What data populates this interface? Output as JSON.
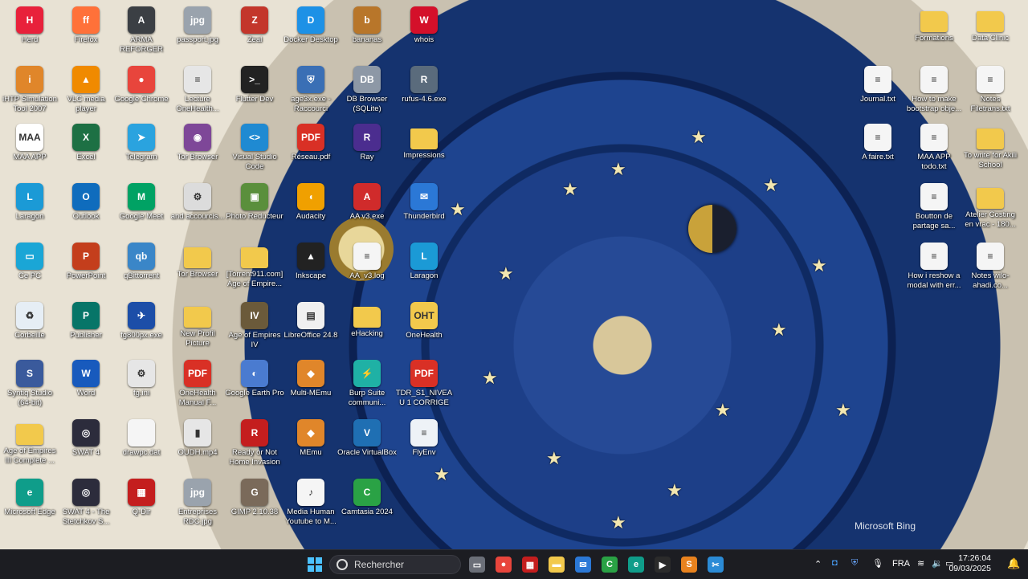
{
  "desktop": {
    "watermark": "Microsoft Bing",
    "icons": [
      {
        "label": "Herd",
        "icon": "herd-icon",
        "color": "#e8213b",
        "glyph": "H"
      },
      {
        "label": "Firefox",
        "icon": "firefox-icon",
        "color": "#ff7139",
        "glyph": "ff"
      },
      {
        "label": "ARMA REFORGER",
        "icon": "arma-icon",
        "color": "#3b3f44",
        "glyph": "A"
      },
      {
        "label": "passport.jpg",
        "icon": "image-file-icon",
        "color": "#9aa3ad",
        "glyph": "jpg"
      },
      {
        "label": "Zeal",
        "icon": "zeal-icon",
        "color": "#c3362b",
        "glyph": "Z"
      },
      {
        "label": "Docker Desktop",
        "icon": "docker-icon",
        "color": "#1d91e6",
        "glyph": "D"
      },
      {
        "label": "bananas",
        "icon": "bananas-icon",
        "color": "#b8762a",
        "glyph": "b"
      },
      {
        "label": "whois",
        "icon": "whois-icon",
        "color": "#d4102a",
        "glyph": "W"
      },
      {
        "label": "iHTP Simulation Tool 2007",
        "icon": "ihtp-icon",
        "color": "#e0862a",
        "glyph": "i"
      },
      {
        "label": "VLC media player",
        "icon": "vlc-icon",
        "color": "#f08a00",
        "glyph": "▲"
      },
      {
        "label": "Google Chrome",
        "icon": "chrome-icon",
        "color": "#e8453c",
        "glyph": "●"
      },
      {
        "label": "Lecture OneHealth...",
        "icon": "document-icon",
        "color": "#e6e6e6",
        "glyph": "≡"
      },
      {
        "label": "Flutter Dev",
        "icon": "terminal-icon",
        "color": "#222",
        "glyph": ">_"
      },
      {
        "label": "age3x.exe - Raccourci",
        "icon": "shield-exe-icon",
        "color": "#3a6fb5",
        "glyph": "⛨"
      },
      {
        "label": "DB Browser (SQLite)",
        "icon": "database-icon",
        "color": "#8d98a6",
        "glyph": "DB"
      },
      {
        "label": "rufus-4.6.exe",
        "icon": "rufus-icon",
        "color": "#5a6b7c",
        "glyph": "R"
      },
      {
        "label": "MAA APP",
        "icon": "maa-icon",
        "color": "#ffffff",
        "glyph": "MAA"
      },
      {
        "label": "Excel",
        "icon": "excel-icon",
        "color": "#1d7044",
        "glyph": "X"
      },
      {
        "label": "Telegram",
        "icon": "telegram-icon",
        "color": "#2aa3df",
        "glyph": "➤"
      },
      {
        "label": "Tor Browser",
        "icon": "tor-icon",
        "color": "#7e4798",
        "glyph": "◉"
      },
      {
        "label": "Visual Studio Code",
        "icon": "vscode-icon",
        "color": "#1f8ad2",
        "glyph": "<>"
      },
      {
        "label": "Réseau.pdf",
        "icon": "pdf-icon",
        "color": "#d93025",
        "glyph": "PDF"
      },
      {
        "label": "Ray",
        "icon": "ray-icon",
        "color": "#4b2d8f",
        "glyph": "R"
      },
      {
        "label": "Impressions",
        "icon": "folder-icon",
        "color": "#f2c94c",
        "glyph": ""
      },
      {
        "label": "Laragon",
        "icon": "laragon-icon",
        "color": "#1b9ad6",
        "glyph": "L"
      },
      {
        "label": "Outlook",
        "icon": "outlook-icon",
        "color": "#0f6cbd",
        "glyph": "O"
      },
      {
        "label": "Google Meet",
        "icon": "meet-icon",
        "color": "#00a264",
        "glyph": "M"
      },
      {
        "label": "and accourcis...",
        "icon": "shortcut-icon",
        "color": "#dcdcdc",
        "glyph": "⚙"
      },
      {
        "label": "Photo Reducteur",
        "icon": "photo-icon",
        "color": "#5a8f3c",
        "glyph": "▣"
      },
      {
        "label": "Audacity",
        "icon": "audacity-icon",
        "color": "#f0a000",
        "glyph": "◖"
      },
      {
        "label": "AA v3.exe",
        "icon": "aa-icon",
        "color": "#d02b2b",
        "glyph": "A"
      },
      {
        "label": "Thunderbird",
        "icon": "thunderbird-icon",
        "color": "#2b78d6",
        "glyph": "✉"
      },
      {
        "label": "Ce PC",
        "icon": "computer-icon",
        "color": "#1aa6d6",
        "glyph": "▭"
      },
      {
        "label": "PowerPoint",
        "icon": "powerpoint-icon",
        "color": "#c43e1c",
        "glyph": "P"
      },
      {
        "label": "qBittorrent",
        "icon": "qbittorrent-icon",
        "color": "#3a86c8",
        "glyph": "qb"
      },
      {
        "label": "Tor Browser",
        "icon": "tor-folder-icon",
        "color": "#f2c94c",
        "glyph": ""
      },
      {
        "label": "[Torrent911.com] Age of Empire...",
        "icon": "folder-icon",
        "color": "#f2c94c",
        "glyph": ""
      },
      {
        "label": "Inkscape",
        "icon": "inkscape-icon",
        "color": "#222",
        "glyph": "▲"
      },
      {
        "label": "AA_v3.log",
        "icon": "text-file-icon",
        "color": "#f5f5f5",
        "glyph": "≡"
      },
      {
        "label": "Laragon",
        "icon": "laragon-icon",
        "color": "#1b9ad6",
        "glyph": "L"
      },
      {
        "label": "Corbeille",
        "icon": "recycle-bin-icon",
        "color": "#e6eef5",
        "glyph": "♻"
      },
      {
        "label": "Publisher",
        "icon": "publisher-icon",
        "color": "#077568",
        "glyph": "P"
      },
      {
        "label": "fg800px.exe",
        "icon": "exe-icon",
        "color": "#1c4ea8",
        "glyph": "✈"
      },
      {
        "label": "New Profil Picture",
        "icon": "folder-icon",
        "color": "#f2c94c",
        "glyph": ""
      },
      {
        "label": "Age of Empires IV",
        "icon": "aoe4-icon",
        "color": "#6b5a3a",
        "glyph": "IV"
      },
      {
        "label": "LibreOffice 24.8",
        "icon": "libreoffice-icon",
        "color": "#f0f0f0",
        "glyph": "▤"
      },
      {
        "label": "eHacking",
        "icon": "folder-icon",
        "color": "#f2c94c",
        "glyph": ""
      },
      {
        "label": "OneHealth",
        "icon": "oht-icon",
        "color": "#f2c94c",
        "glyph": "OHT"
      },
      {
        "label": "Syntiq Studio (64-bit)",
        "icon": "syntiq-icon",
        "color": "#3a5a9c",
        "glyph": "S"
      },
      {
        "label": "Word",
        "icon": "word-icon",
        "color": "#185abd",
        "glyph": "W"
      },
      {
        "label": "fg.ini",
        "icon": "ini-file-icon",
        "color": "#e6e6e6",
        "glyph": "⚙"
      },
      {
        "label": "OneHealth Manual F...",
        "icon": "pdf-icon",
        "color": "#d93025",
        "glyph": "PDF"
      },
      {
        "label": "Google Earth Pro",
        "icon": "google-earth-icon",
        "color": "#4a7bd0",
        "glyph": "◐"
      },
      {
        "label": "Multi-MEmu",
        "icon": "memu-icon",
        "color": "#e0862a",
        "glyph": "◆"
      },
      {
        "label": "Burp Suite communi...",
        "icon": "burp-icon",
        "color": "#1fb1a5",
        "glyph": "⚡"
      },
      {
        "label": "TDR_S1_NIVEAU 1 CORRIGE II.pdf",
        "icon": "pdf-icon",
        "color": "#d93025",
        "glyph": "PDF"
      },
      {
        "label": "Age of Empires III Complete ...",
        "icon": "folder-icon",
        "color": "#f2c94c",
        "glyph": ""
      },
      {
        "label": "SWAT 4",
        "icon": "swat-icon",
        "color": "#2c2c3c",
        "glyph": "◎"
      },
      {
        "label": "drawpc.dat",
        "icon": "blank-file-icon",
        "color": "#f5f5f5",
        "glyph": ""
      },
      {
        "label": "OUDH.mp4",
        "icon": "video-file-icon",
        "color": "#e6e6e6",
        "glyph": "▮"
      },
      {
        "label": "Ready or Not Home Invasion",
        "icon": "ready-or-not-icon",
        "color": "#c41e1e",
        "glyph": "R"
      },
      {
        "label": "MEmu",
        "icon": "memu-icon",
        "color": "#e0862a",
        "glyph": "◆"
      },
      {
        "label": "Oracle VirtualBox",
        "icon": "virtualbox-icon",
        "color": "#1f6fb3",
        "glyph": "V"
      },
      {
        "label": "FlyEnv",
        "icon": "flyenv-icon",
        "color": "#eef2f7",
        "glyph": "≡"
      },
      {
        "label": "Microsoft Edge",
        "icon": "edge-icon",
        "color": "#0f9d8a",
        "glyph": "e"
      },
      {
        "label": "SWAT 4 - The Stetchkov S...",
        "icon": "swat-icon",
        "color": "#2c2c3c",
        "glyph": "◎"
      },
      {
        "label": "Q-Dir",
        "icon": "qdir-icon",
        "color": "#c41e1e",
        "glyph": "▦"
      },
      {
        "label": "Entreprises RDC.jpg",
        "icon": "image-file-icon",
        "color": "#9aa3ad",
        "glyph": "jpg"
      },
      {
        "label": "GIMP 2.10.38",
        "icon": "gimp-icon",
        "color": "#7a6a5a",
        "glyph": "G"
      },
      {
        "label": "Media Human Youtube to M...",
        "icon": "mediahuman-icon",
        "color": "#f5f5f5",
        "glyph": "♪"
      },
      {
        "label": "Camtasia 2024",
        "icon": "camtasia-icon",
        "color": "#2aa245",
        "glyph": "C"
      },
      {
        "label": "Formations",
        "icon": "folder-icon",
        "color": "#f2c94c",
        "glyph": ""
      },
      {
        "label": "Data Clinic",
        "icon": "folder-icon",
        "color": "#f2c94c",
        "glyph": ""
      },
      {
        "label": "Journal.txt",
        "icon": "text-file-icon",
        "color": "#f5f5f5",
        "glyph": "≡"
      },
      {
        "label": "How to make bootstrap obje...",
        "icon": "text-file-icon",
        "color": "#f5f5f5",
        "glyph": "≡"
      },
      {
        "label": "Notes Filetrans.txt",
        "icon": "text-file-icon",
        "color": "#f5f5f5",
        "glyph": "≡"
      },
      {
        "label": "A faire.txt",
        "icon": "text-file-icon",
        "color": "#f5f5f5",
        "glyph": "≡"
      },
      {
        "label": "MAA APP todo.txt",
        "icon": "text-file-icon",
        "color": "#f5f5f5",
        "glyph": "≡"
      },
      {
        "label": "To write for Akili School",
        "icon": "folder-icon",
        "color": "#f2c94c",
        "glyph": ""
      },
      {
        "label": "Boutton de partage sa...",
        "icon": "text-file-icon",
        "color": "#f5f5f5",
        "glyph": "≡"
      },
      {
        "label": "Atelier Costing en vrac - 180...",
        "icon": "folder-icon",
        "color": "#f2c94c",
        "glyph": ""
      },
      {
        "label": "How i reshow a modal with err...",
        "icon": "text-file-icon",
        "color": "#f5f5f5",
        "glyph": "≡"
      },
      {
        "label": "Notes wilo-ahadi.co...",
        "icon": "text-file-icon",
        "color": "#f5f5f5",
        "glyph": "≡"
      }
    ]
  },
  "taskbar": {
    "search_placeholder": "Rechercher",
    "pinned": [
      {
        "name": "task-view-icon",
        "color": "#6b6f78",
        "glyph": "▭"
      },
      {
        "name": "chrome-icon",
        "color": "#e8453c",
        "glyph": "●"
      },
      {
        "name": "qdir-icon",
        "color": "#c41e1e",
        "glyph": "▦"
      },
      {
        "name": "file-explorer-icon",
        "color": "#f2c94c",
        "glyph": "▬"
      },
      {
        "name": "thunderbird-icon",
        "color": "#2b78d6",
        "glyph": "✉"
      },
      {
        "name": "camtasia-icon",
        "color": "#2aa245",
        "glyph": "C"
      },
      {
        "name": "edge-icon",
        "color": "#0f9d8a",
        "glyph": "e"
      },
      {
        "name": "media-player-icon",
        "color": "#2b2b2b",
        "glyph": "▶"
      },
      {
        "name": "sublime-text-icon",
        "color": "#e8821e",
        "glyph": "S"
      },
      {
        "name": "snipping-tool-icon",
        "color": "#2b8bd6",
        "glyph": "✂"
      }
    ],
    "language": "FRA",
    "time": "17:26:04",
    "date": "09/03/2025"
  }
}
